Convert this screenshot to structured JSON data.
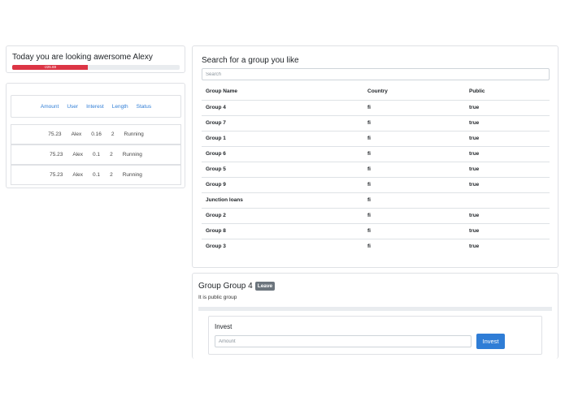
{
  "greeting": {
    "text": "Today you are looking awersome Alexy",
    "balance_label": "-225.69",
    "balance_fraction": 0.45,
    "bar_color": "#dc3545"
  },
  "loans": {
    "headers": [
      "Amount",
      "User",
      "Interest",
      "Length",
      "Status"
    ],
    "rows": [
      [
        "75.23",
        "Alex",
        "0.16",
        "2",
        "Running"
      ],
      [
        "75.23",
        "Alex",
        "0.1",
        "2",
        "Running"
      ],
      [
        "75.23",
        "Alex",
        "0.1",
        "2",
        "Running"
      ]
    ],
    "header_color": "#2f7dd6"
  },
  "search": {
    "title": "Search for a group you like",
    "placeholder": "Search",
    "columns": [
      "Group Name",
      "Country",
      "Public"
    ],
    "rows": [
      [
        "Group 4",
        "fi",
        "true"
      ],
      [
        "Group 7",
        "fi",
        "true"
      ],
      [
        "Group 1",
        "fi",
        "true"
      ],
      [
        "Group 6",
        "fi",
        "true"
      ],
      [
        "Group 5",
        "fi",
        "true"
      ],
      [
        "Group 9",
        "fi",
        "true"
      ],
      [
        "Junction loans",
        "fi",
        ""
      ],
      [
        "Group 2",
        "fi",
        "true"
      ],
      [
        "Group 8",
        "fi",
        "true"
      ],
      [
        "Group 3",
        "fi",
        "true"
      ]
    ]
  },
  "group": {
    "title": "Group Group 4",
    "leave_label": "Leave",
    "description": "It is public group",
    "invest": {
      "label": "Invest",
      "placeholder": "Amount",
      "button_label": "Invest",
      "button_color": "#2f7dd6"
    }
  }
}
